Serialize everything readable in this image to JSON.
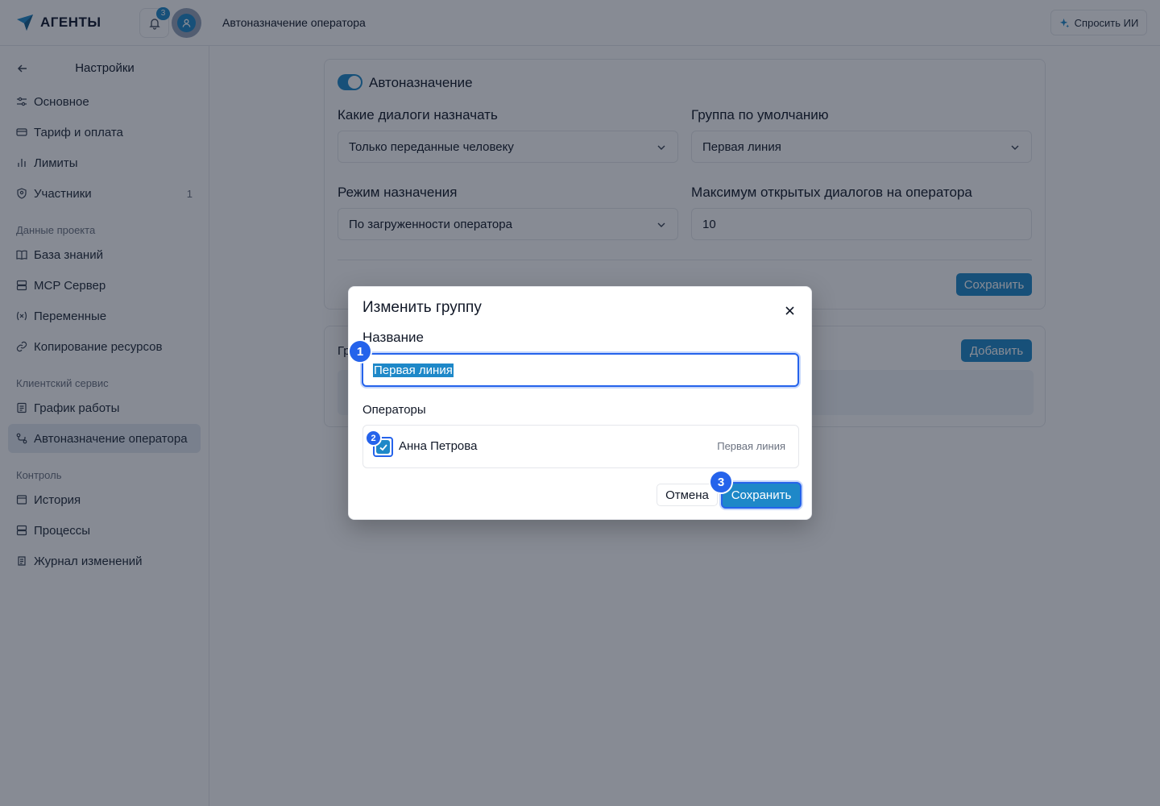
{
  "app": {
    "name": "АГЕНТЫ",
    "notifications_count": "3"
  },
  "header": {
    "title": "Автоназначение оператора",
    "ask_ai": "Спросить ИИ"
  },
  "sidebar": {
    "title": "Настройки",
    "items_main": [
      {
        "label": "Основное"
      },
      {
        "label": "Тариф и оплата"
      },
      {
        "label": "Лимиты"
      },
      {
        "label": "Участники",
        "count": "1"
      }
    ],
    "section_project": "Данные проекта",
    "items_project": [
      {
        "label": "База знаний"
      },
      {
        "label": "MCP Сервер"
      },
      {
        "label": "Переменные"
      },
      {
        "label": "Копирование ресурсов"
      }
    ],
    "section_client": "Клиентский сервис",
    "items_client": [
      {
        "label": "График работы"
      },
      {
        "label": "Автоназначение оператора"
      }
    ],
    "section_control": "Контроль",
    "items_control": [
      {
        "label": "История"
      },
      {
        "label": "Процессы"
      },
      {
        "label": "Журнал изменений"
      }
    ]
  },
  "settings": {
    "toggle_label": "Автоназначение",
    "toggle_on": true,
    "which_dialogs": {
      "label": "Какие диалоги назначать",
      "value": "Только переданные человеку"
    },
    "default_group": {
      "label": "Группа по умолчанию",
      "value": "Первая линия"
    },
    "mode": {
      "label": "Режим назначения",
      "value": "По загруженности оператора"
    },
    "max_dialogs": {
      "label": "Максимум открытых диалогов на оператора",
      "value": "10"
    },
    "save": "Сохранить"
  },
  "groups": {
    "title_partial": "Гр",
    "add": "Добавить"
  },
  "dialog": {
    "title": "Изменить группу",
    "name_label": "Название",
    "name_value": "Первая линия",
    "operators_label": "Операторы",
    "operators": [
      {
        "name": "Анна Петрова",
        "group": "Первая линия",
        "checked": true
      }
    ],
    "cancel": "Отмена",
    "save": "Сохранить"
  },
  "markers": [
    "1",
    "2",
    "3"
  ],
  "colors": {
    "accent": "#1e88c8",
    "focus": "#2563eb",
    "marker": "#2563eb"
  }
}
